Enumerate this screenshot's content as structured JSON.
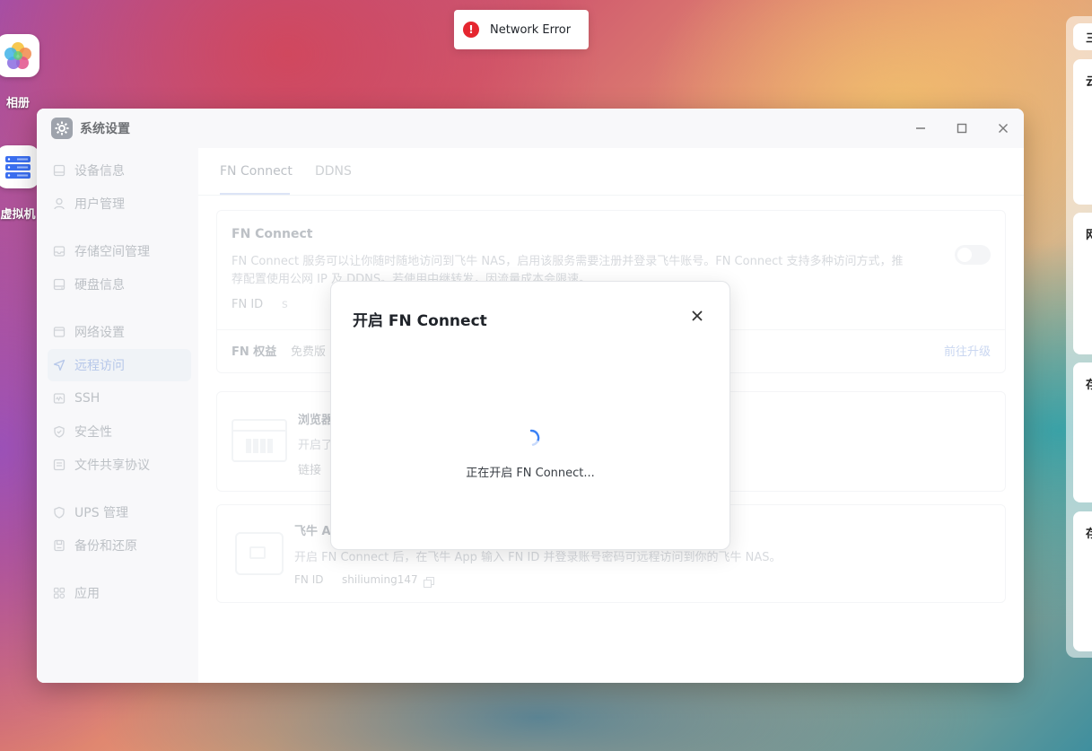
{
  "desktop": {
    "icons": [
      {
        "label": "相册",
        "icon": "photos-icon"
      },
      {
        "label": "虚拟机",
        "icon": "virtual-machine-icon"
      }
    ]
  },
  "toast": {
    "message": "Network Error",
    "icon": "error-icon",
    "color": "#e5262f"
  },
  "window": {
    "title": "系统设置",
    "sidebar": {
      "items": [
        {
          "label": "设备信息",
          "icon": "device-icon"
        },
        {
          "label": "用户管理",
          "icon": "user-icon"
        },
        {
          "label": "存储空间管理",
          "icon": "storage-icon"
        },
        {
          "label": "硬盘信息",
          "icon": "disk-icon"
        },
        {
          "label": "网络设置",
          "icon": "network-icon"
        },
        {
          "label": "远程访问",
          "icon": "remote-access-icon",
          "active": true
        },
        {
          "label": "SSH",
          "icon": "ssh-icon"
        },
        {
          "label": "安全性",
          "icon": "shield-icon"
        },
        {
          "label": "文件共享协议",
          "icon": "file-share-icon"
        },
        {
          "label": "UPS 管理",
          "icon": "ups-icon"
        },
        {
          "label": "备份和还原",
          "icon": "backup-icon"
        },
        {
          "label": "应用",
          "icon": "apps-icon"
        }
      ]
    },
    "tabs": [
      {
        "label": "FN Connect",
        "active": true
      },
      {
        "label": "DDNS",
        "active": false
      }
    ],
    "fn_card": {
      "title": "FN Connect",
      "desc_line1": "FN Connect 服务可以让你随时随地访问到飞牛 NAS，启用该服务需要注册并登录飞牛账号。FN Connect 支持多种访问方式，推",
      "desc_line2": "荐配置使用公网 IP 及 DDNS。若使用中继转发，因流量成本会限速。",
      "id_label": "FN ID",
      "id_value": "s",
      "rights_label": "FN 权益",
      "rights_value": "免费版",
      "upgrade_link": "前往升级",
      "toggle_on": false
    },
    "browser_card": {
      "title": "浏览器",
      "line": "开启了",
      "link_label": "链接"
    },
    "app_card": {
      "title": "飞牛 A",
      "desc": "开启 FN Connect 后，在飞牛 App 输入 FN ID 并登录账号密码可远程访问到你的飞牛 NAS。",
      "id_label": "FN ID",
      "id_value": "shiliuming147"
    }
  },
  "modal": {
    "title": "开启 FN Connect",
    "loading_text": "正在开启 FN Connect..."
  },
  "right_panel": {
    "cards": [
      "云",
      "网",
      "存",
      "存"
    ]
  }
}
